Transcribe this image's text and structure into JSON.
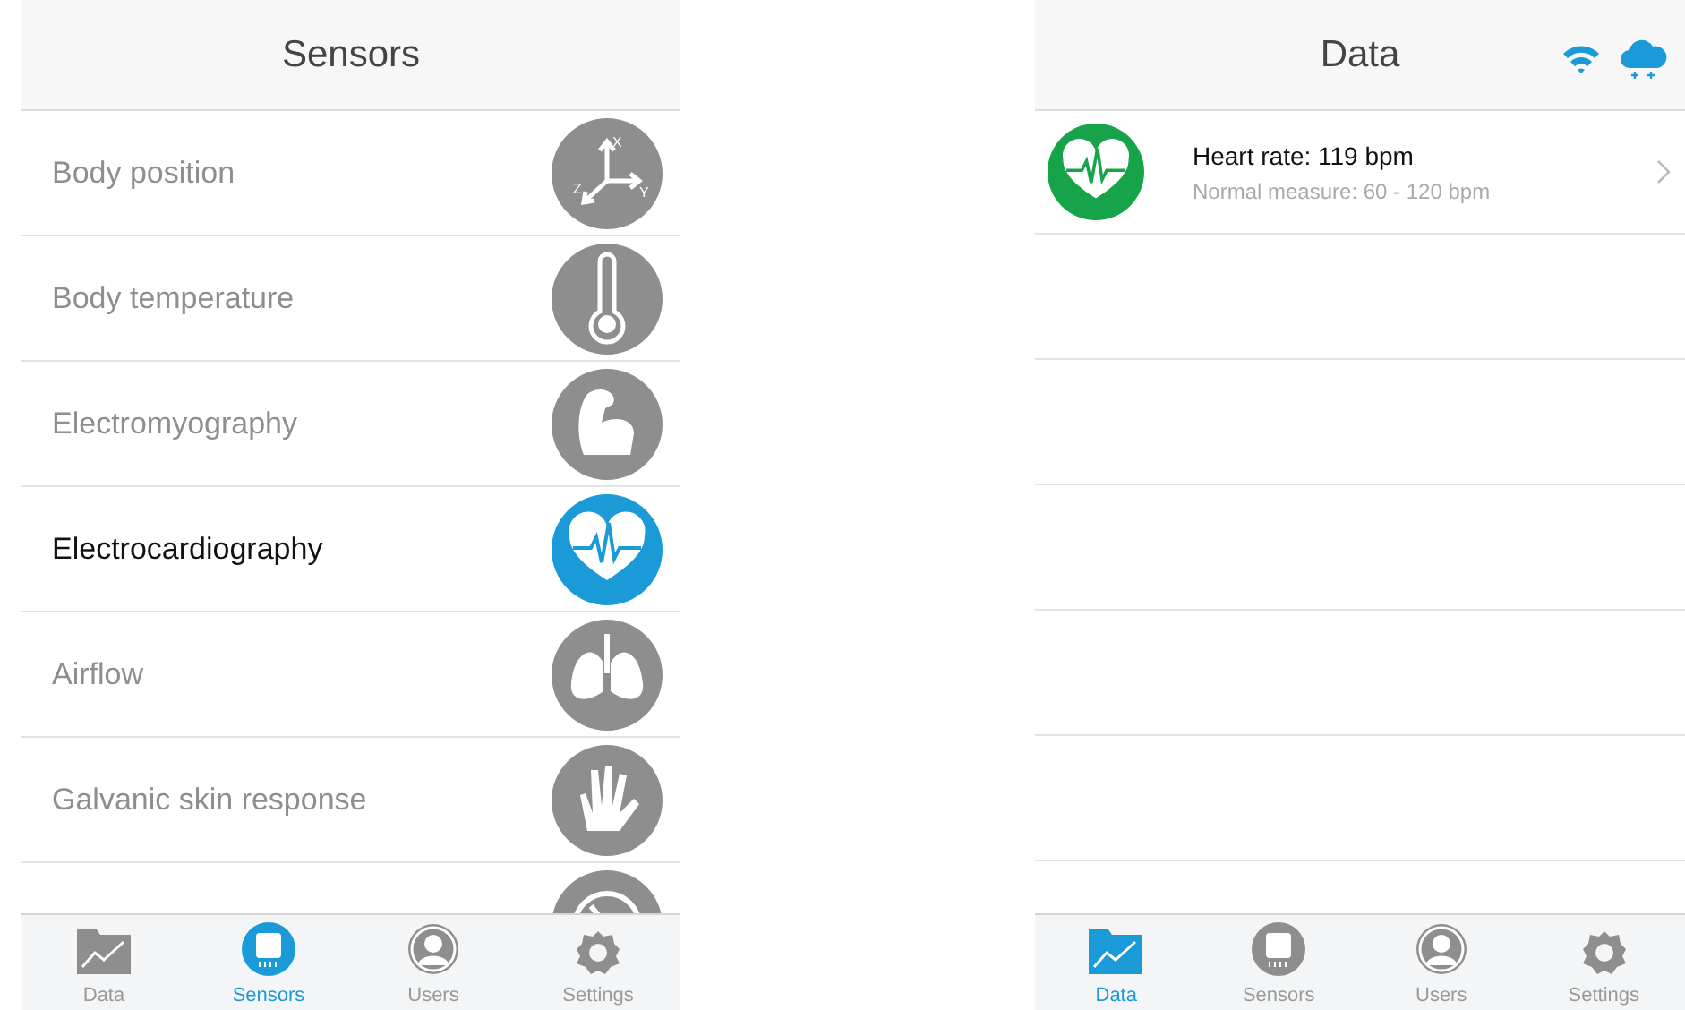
{
  "sensors_screen": {
    "title": "Sensors",
    "axis_labels": [
      "X",
      "Z",
      "Y"
    ],
    "items": [
      {
        "label": "Body position",
        "selected": false
      },
      {
        "label": "Body temperature",
        "selected": false
      },
      {
        "label": "Electromyography",
        "selected": false
      },
      {
        "label": "Electrocardiography",
        "selected": true
      },
      {
        "label": "Airflow",
        "selected": false
      },
      {
        "label": "Galvanic skin response",
        "selected": false
      }
    ],
    "tabs": [
      {
        "label": "Data",
        "selected": false
      },
      {
        "label": "Sensors",
        "selected": true
      },
      {
        "label": "Users",
        "selected": false
      },
      {
        "label": "Settings",
        "selected": false
      }
    ]
  },
  "data_screen": {
    "title": "Data",
    "readings": [
      {
        "title": "Heart rate: 119 bpm",
        "subtitle": "Normal measure: 60 - 120 bpm"
      }
    ],
    "tabs": [
      {
        "label": "Data",
        "selected": true
      },
      {
        "label": "Sensors",
        "selected": false
      },
      {
        "label": "Users",
        "selected": false
      },
      {
        "label": "Settings",
        "selected": false
      }
    ]
  }
}
